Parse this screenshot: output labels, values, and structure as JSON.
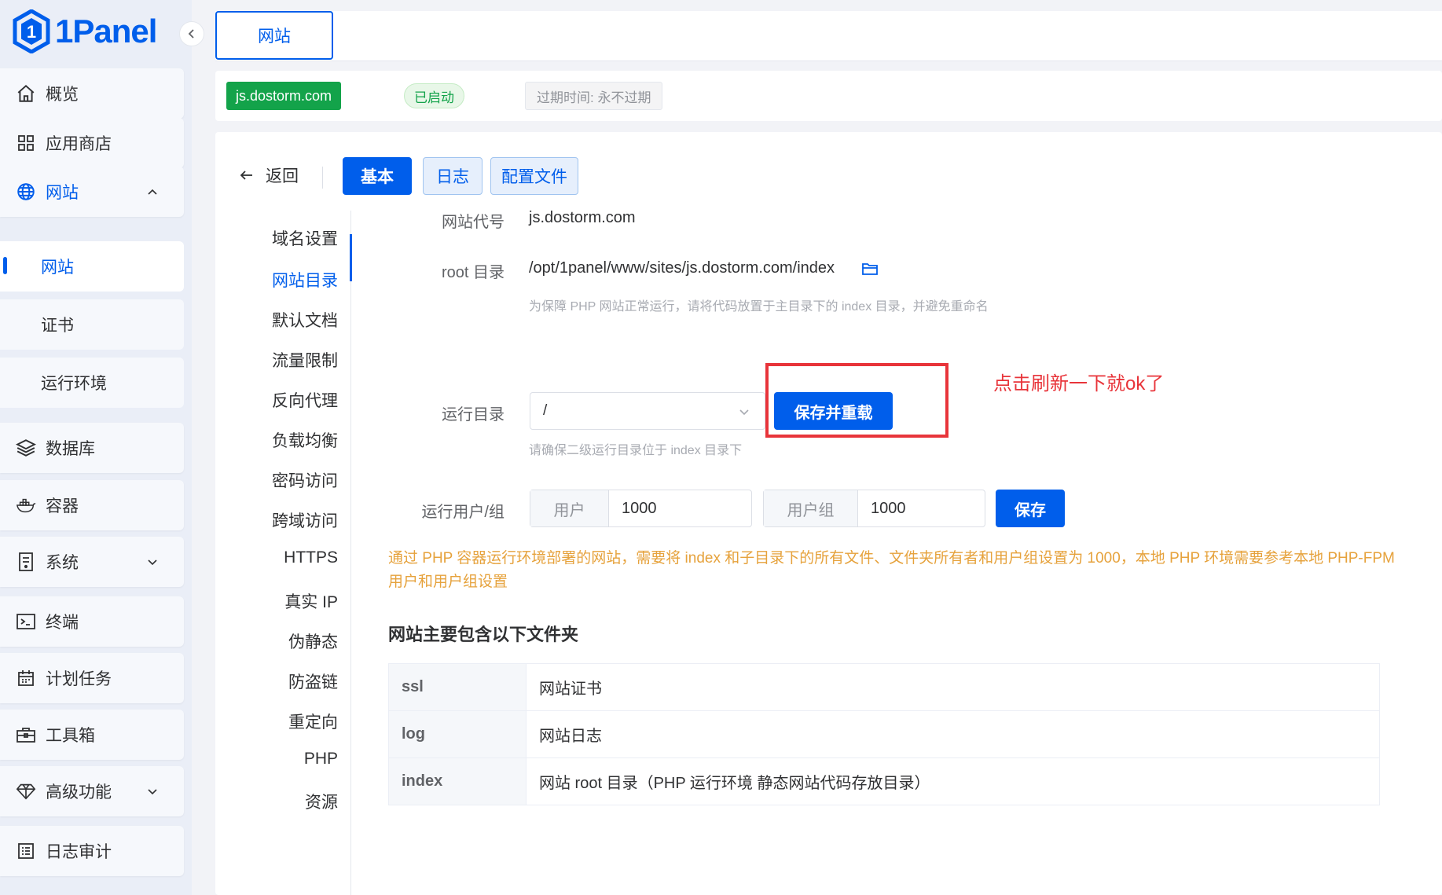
{
  "sidebar": {
    "logo": "1Panel",
    "items": [
      {
        "label": "概览",
        "icon": "home-icon"
      },
      {
        "label": "应用商店",
        "icon": "grid-icon"
      },
      {
        "label": "网站",
        "icon": "globe-icon"
      },
      {
        "label": "网站"
      },
      {
        "label": "证书"
      },
      {
        "label": "运行环境"
      },
      {
        "label": "数据库",
        "icon": "layers-icon"
      },
      {
        "label": "容器",
        "icon": "docker-icon"
      },
      {
        "label": "系统",
        "icon": "server-icon"
      },
      {
        "label": "终端",
        "icon": "terminal-icon"
      },
      {
        "label": "计划任务",
        "icon": "calendar-icon"
      },
      {
        "label": "工具箱",
        "icon": "toolbox-icon"
      },
      {
        "label": "高级功能",
        "icon": "diamond-icon"
      },
      {
        "label": "日志审计",
        "icon": "log-icon"
      }
    ]
  },
  "tabbar": {
    "active_tab": "网站"
  },
  "info": {
    "site": "js.dostorm.com",
    "status": "已启动",
    "expire": "过期时间: 永不过期"
  },
  "toolbar": {
    "back": "返回",
    "tabs": [
      "基本",
      "日志",
      "配置文件"
    ]
  },
  "side_nav": [
    "域名设置",
    "网站目录",
    "默认文档",
    "流量限制",
    "反向代理",
    "负载均衡",
    "密码访问",
    "跨域访问",
    "HTTPS",
    "真实 IP",
    "伪静态",
    "防盗链",
    "重定向",
    "PHP",
    "资源"
  ],
  "form": {
    "alias_label": "网站代号",
    "alias_value": "js.dostorm.com",
    "root_label": "root 目录",
    "root_value": "/opt/1panel/www/sites/js.dostorm.com/index",
    "root_hint": "为保障 PHP 网站正常运行，请将代码放置于主目录下的 index 目录，并避免重命名",
    "run_dir_label": "运行目录",
    "run_dir_value": "/",
    "run_dir_hint": "请确保二级运行目录位于 index 目录下",
    "save_reload": "保存并重载",
    "annotation": "点击刷新一下就ok了",
    "user_group_label": "运行用户/组",
    "user_prefix": "用户",
    "user_value": "1000",
    "group_prefix": "用户组",
    "group_value": "1000",
    "save": "保存"
  },
  "warning": "通过 PHP 容器运行环境部署的网站，需要将 index 和子目录下的所有文件、文件夹所有者和用户组设置为 1000，本地 PHP 环境需要参考本地 PHP-FPM 用户和用户组设置",
  "folders": {
    "title": "网站主要包含以下文件夹",
    "rows": [
      {
        "key": "ssl",
        "desc": "网站证书"
      },
      {
        "key": "log",
        "desc": "网站日志"
      },
      {
        "key": "index",
        "desc": "网站 root 目录（PHP 运行环境 静态网站代码存放目录）"
      }
    ]
  },
  "colors": {
    "primary": "#005eeb",
    "success": "#13a34a",
    "warning": "#e6a23c",
    "annotation": "#e8343a"
  }
}
